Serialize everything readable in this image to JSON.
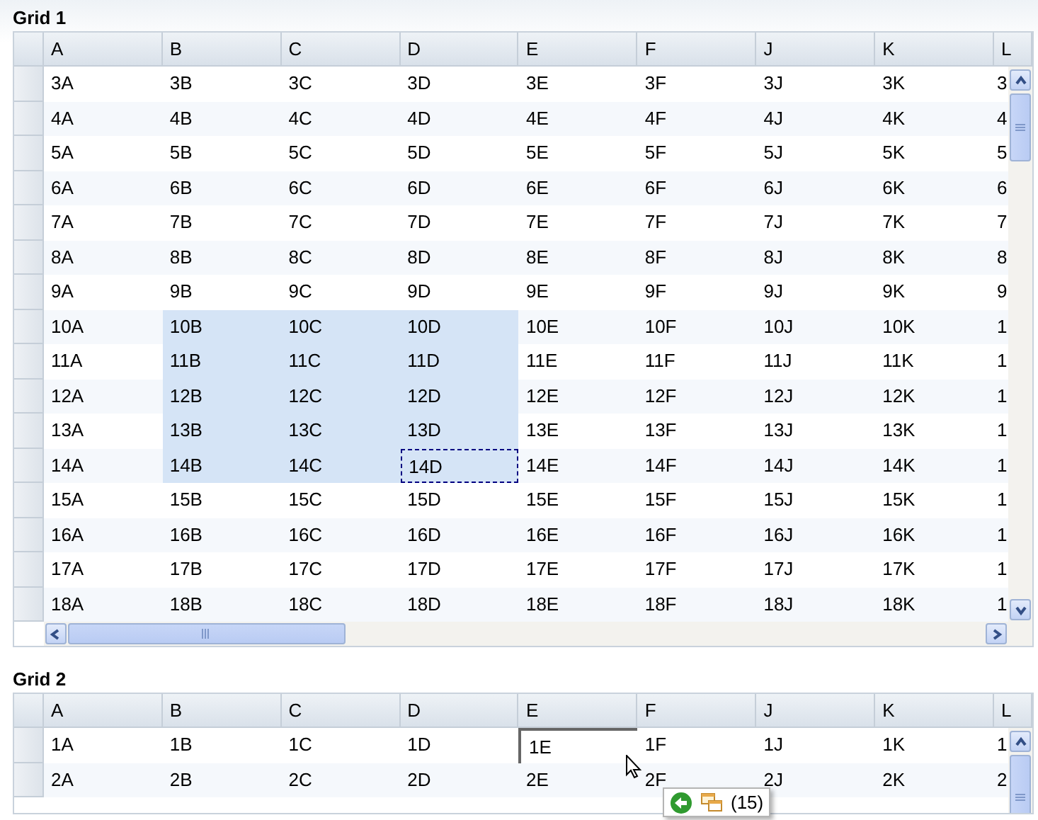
{
  "grids": [
    {
      "title": "Grid 1",
      "kind": "dashed",
      "columns": [
        "A",
        "B",
        "C",
        "D",
        "E",
        "F",
        "J",
        "K",
        "L"
      ],
      "rows": [
        {
          "cells": [
            {
              "text": "3A",
              "selected": false,
              "focused": false
            },
            {
              "text": "3B",
              "selected": false,
              "focused": false
            },
            {
              "text": "3C",
              "selected": false,
              "focused": false
            },
            {
              "text": "3D",
              "selected": false,
              "focused": false
            },
            {
              "text": "3E",
              "selected": false,
              "focused": false
            },
            {
              "text": "3F",
              "selected": false,
              "focused": false
            },
            {
              "text": "3J",
              "selected": false,
              "focused": false
            },
            {
              "text": "3K",
              "selected": false,
              "focused": false
            },
            {
              "text": "3",
              "selected": false,
              "focused": false
            }
          ]
        },
        {
          "cells": [
            {
              "text": "4A",
              "selected": false,
              "focused": false
            },
            {
              "text": "4B",
              "selected": false,
              "focused": false
            },
            {
              "text": "4C",
              "selected": false,
              "focused": false
            },
            {
              "text": "4D",
              "selected": false,
              "focused": false
            },
            {
              "text": "4E",
              "selected": false,
              "focused": false
            },
            {
              "text": "4F",
              "selected": false,
              "focused": false
            },
            {
              "text": "4J",
              "selected": false,
              "focused": false
            },
            {
              "text": "4K",
              "selected": false,
              "focused": false
            },
            {
              "text": "4",
              "selected": false,
              "focused": false
            }
          ]
        },
        {
          "cells": [
            {
              "text": "5A",
              "selected": false,
              "focused": false
            },
            {
              "text": "5B",
              "selected": false,
              "focused": false
            },
            {
              "text": "5C",
              "selected": false,
              "focused": false
            },
            {
              "text": "5D",
              "selected": false,
              "focused": false
            },
            {
              "text": "5E",
              "selected": false,
              "focused": false
            },
            {
              "text": "5F",
              "selected": false,
              "focused": false
            },
            {
              "text": "5J",
              "selected": false,
              "focused": false
            },
            {
              "text": "5K",
              "selected": false,
              "focused": false
            },
            {
              "text": "5",
              "selected": false,
              "focused": false
            }
          ]
        },
        {
          "cells": [
            {
              "text": "6A",
              "selected": false,
              "focused": false
            },
            {
              "text": "6B",
              "selected": false,
              "focused": false
            },
            {
              "text": "6C",
              "selected": false,
              "focused": false
            },
            {
              "text": "6D",
              "selected": false,
              "focused": false
            },
            {
              "text": "6E",
              "selected": false,
              "focused": false
            },
            {
              "text": "6F",
              "selected": false,
              "focused": false
            },
            {
              "text": "6J",
              "selected": false,
              "focused": false
            },
            {
              "text": "6K",
              "selected": false,
              "focused": false
            },
            {
              "text": "6",
              "selected": false,
              "focused": false
            }
          ]
        },
        {
          "cells": [
            {
              "text": "7A",
              "selected": false,
              "focused": false
            },
            {
              "text": "7B",
              "selected": false,
              "focused": false
            },
            {
              "text": "7C",
              "selected": false,
              "focused": false
            },
            {
              "text": "7D",
              "selected": false,
              "focused": false
            },
            {
              "text": "7E",
              "selected": false,
              "focused": false
            },
            {
              "text": "7F",
              "selected": false,
              "focused": false
            },
            {
              "text": "7J",
              "selected": false,
              "focused": false
            },
            {
              "text": "7K",
              "selected": false,
              "focused": false
            },
            {
              "text": "7",
              "selected": false,
              "focused": false
            }
          ]
        },
        {
          "cells": [
            {
              "text": "8A",
              "selected": false,
              "focused": false
            },
            {
              "text": "8B",
              "selected": false,
              "focused": false
            },
            {
              "text": "8C",
              "selected": false,
              "focused": false
            },
            {
              "text": "8D",
              "selected": false,
              "focused": false
            },
            {
              "text": "8E",
              "selected": false,
              "focused": false
            },
            {
              "text": "8F",
              "selected": false,
              "focused": false
            },
            {
              "text": "8J",
              "selected": false,
              "focused": false
            },
            {
              "text": "8K",
              "selected": false,
              "focused": false
            },
            {
              "text": "8",
              "selected": false,
              "focused": false
            }
          ]
        },
        {
          "cells": [
            {
              "text": "9A",
              "selected": false,
              "focused": false
            },
            {
              "text": "9B",
              "selected": false,
              "focused": false
            },
            {
              "text": "9C",
              "selected": false,
              "focused": false
            },
            {
              "text": "9D",
              "selected": false,
              "focused": false
            },
            {
              "text": "9E",
              "selected": false,
              "focused": false
            },
            {
              "text": "9F",
              "selected": false,
              "focused": false
            },
            {
              "text": "9J",
              "selected": false,
              "focused": false
            },
            {
              "text": "9K",
              "selected": false,
              "focused": false
            },
            {
              "text": "9",
              "selected": false,
              "focused": false
            }
          ]
        },
        {
          "cells": [
            {
              "text": "10A",
              "selected": false,
              "focused": false
            },
            {
              "text": "10B",
              "selected": true,
              "focused": false
            },
            {
              "text": "10C",
              "selected": true,
              "focused": false
            },
            {
              "text": "10D",
              "selected": true,
              "focused": false
            },
            {
              "text": "10E",
              "selected": false,
              "focused": false
            },
            {
              "text": "10F",
              "selected": false,
              "focused": false
            },
            {
              "text": "10J",
              "selected": false,
              "focused": false
            },
            {
              "text": "10K",
              "selected": false,
              "focused": false
            },
            {
              "text": "1",
              "selected": false,
              "focused": false
            }
          ]
        },
        {
          "cells": [
            {
              "text": "11A",
              "selected": false,
              "focused": false
            },
            {
              "text": "11B",
              "selected": true,
              "focused": false
            },
            {
              "text": "11C",
              "selected": true,
              "focused": false
            },
            {
              "text": "11D",
              "selected": true,
              "focused": false
            },
            {
              "text": "11E",
              "selected": false,
              "focused": false
            },
            {
              "text": "11F",
              "selected": false,
              "focused": false
            },
            {
              "text": "11J",
              "selected": false,
              "focused": false
            },
            {
              "text": "11K",
              "selected": false,
              "focused": false
            },
            {
              "text": "1",
              "selected": false,
              "focused": false
            }
          ]
        },
        {
          "cells": [
            {
              "text": "12A",
              "selected": false,
              "focused": false
            },
            {
              "text": "12B",
              "selected": true,
              "focused": false
            },
            {
              "text": "12C",
              "selected": true,
              "focused": false
            },
            {
              "text": "12D",
              "selected": true,
              "focused": false
            },
            {
              "text": "12E",
              "selected": false,
              "focused": false
            },
            {
              "text": "12F",
              "selected": false,
              "focused": false
            },
            {
              "text": "12J",
              "selected": false,
              "focused": false
            },
            {
              "text": "12K",
              "selected": false,
              "focused": false
            },
            {
              "text": "1",
              "selected": false,
              "focused": false
            }
          ]
        },
        {
          "cells": [
            {
              "text": "13A",
              "selected": false,
              "focused": false
            },
            {
              "text": "13B",
              "selected": true,
              "focused": false
            },
            {
              "text": "13C",
              "selected": true,
              "focused": false
            },
            {
              "text": "13D",
              "selected": true,
              "focused": false
            },
            {
              "text": "13E",
              "selected": false,
              "focused": false
            },
            {
              "text": "13F",
              "selected": false,
              "focused": false
            },
            {
              "text": "13J",
              "selected": false,
              "focused": false
            },
            {
              "text": "13K",
              "selected": false,
              "focused": false
            },
            {
              "text": "1",
              "selected": false,
              "focused": false
            }
          ]
        },
        {
          "cells": [
            {
              "text": "14A",
              "selected": false,
              "focused": false
            },
            {
              "text": "14B",
              "selected": true,
              "focused": false
            },
            {
              "text": "14C",
              "selected": true,
              "focused": false
            },
            {
              "text": "14D",
              "selected": true,
              "focused": true
            },
            {
              "text": "14E",
              "selected": false,
              "focused": false
            },
            {
              "text": "14F",
              "selected": false,
              "focused": false
            },
            {
              "text": "14J",
              "selected": false,
              "focused": false
            },
            {
              "text": "14K",
              "selected": false,
              "focused": false
            },
            {
              "text": "1",
              "selected": false,
              "focused": false
            }
          ]
        },
        {
          "cells": [
            {
              "text": "15A",
              "selected": false,
              "focused": false
            },
            {
              "text": "15B",
              "selected": false,
              "focused": false
            },
            {
              "text": "15C",
              "selected": false,
              "focused": false
            },
            {
              "text": "15D",
              "selected": false,
              "focused": false
            },
            {
              "text": "15E",
              "selected": false,
              "focused": false
            },
            {
              "text": "15F",
              "selected": false,
              "focused": false
            },
            {
              "text": "15J",
              "selected": false,
              "focused": false
            },
            {
              "text": "15K",
              "selected": false,
              "focused": false
            },
            {
              "text": "1",
              "selected": false,
              "focused": false
            }
          ]
        },
        {
          "cells": [
            {
              "text": "16A",
              "selected": false,
              "focused": false
            },
            {
              "text": "16B",
              "selected": false,
              "focused": false
            },
            {
              "text": "16C",
              "selected": false,
              "focused": false
            },
            {
              "text": "16D",
              "selected": false,
              "focused": false
            },
            {
              "text": "16E",
              "selected": false,
              "focused": false
            },
            {
              "text": "16F",
              "selected": false,
              "focused": false
            },
            {
              "text": "16J",
              "selected": false,
              "focused": false
            },
            {
              "text": "16K",
              "selected": false,
              "focused": false
            },
            {
              "text": "1",
              "selected": false,
              "focused": false
            }
          ]
        },
        {
          "cells": [
            {
              "text": "17A",
              "selected": false,
              "focused": false
            },
            {
              "text": "17B",
              "selected": false,
              "focused": false
            },
            {
              "text": "17C",
              "selected": false,
              "focused": false
            },
            {
              "text": "17D",
              "selected": false,
              "focused": false
            },
            {
              "text": "17E",
              "selected": false,
              "focused": false
            },
            {
              "text": "17F",
              "selected": false,
              "focused": false
            },
            {
              "text": "17J",
              "selected": false,
              "focused": false
            },
            {
              "text": "17K",
              "selected": false,
              "focused": false
            },
            {
              "text": "1",
              "selected": false,
              "focused": false
            }
          ]
        },
        {
          "cells": [
            {
              "text": "18A",
              "selected": false,
              "focused": false
            },
            {
              "text": "18B",
              "selected": false,
              "focused": false
            },
            {
              "text": "18C",
              "selected": false,
              "focused": false
            },
            {
              "text": "18D",
              "selected": false,
              "focused": false
            },
            {
              "text": "18E",
              "selected": false,
              "focused": false
            },
            {
              "text": "18F",
              "selected": false,
              "focused": false
            },
            {
              "text": "18J",
              "selected": false,
              "focused": false
            },
            {
              "text": "18K",
              "selected": false,
              "focused": false
            },
            {
              "text": "1",
              "selected": false,
              "focused": false
            }
          ]
        }
      ]
    },
    {
      "title": "Grid 2",
      "kind": "solid",
      "columns": [
        "A",
        "B",
        "C",
        "D",
        "E",
        "F",
        "J",
        "K",
        "L"
      ],
      "rows": [
        {
          "cells": [
            {
              "text": "1A",
              "selected": false,
              "focused": false
            },
            {
              "text": "1B",
              "selected": false,
              "focused": false
            },
            {
              "text": "1C",
              "selected": false,
              "focused": false
            },
            {
              "text": "1D",
              "selected": false,
              "focused": false
            },
            {
              "text": "1E",
              "selected": false,
              "focused": true
            },
            {
              "text": "1F",
              "selected": false,
              "focused": false
            },
            {
              "text": "1J",
              "selected": false,
              "focused": false
            },
            {
              "text": "1K",
              "selected": false,
              "focused": false
            },
            {
              "text": "1",
              "selected": false,
              "focused": false
            }
          ]
        },
        {
          "cells": [
            {
              "text": "2A",
              "selected": false,
              "focused": false
            },
            {
              "text": "2B",
              "selected": false,
              "focused": false
            },
            {
              "text": "2C",
              "selected": false,
              "focused": false
            },
            {
              "text": "2D",
              "selected": false,
              "focused": false
            },
            {
              "text": "2E",
              "selected": false,
              "focused": false
            },
            {
              "text": "2F",
              "selected": false,
              "focused": false
            },
            {
              "text": "2J",
              "selected": false,
              "focused": false
            },
            {
              "text": "2K",
              "selected": false,
              "focused": false
            },
            {
              "text": "2",
              "selected": false,
              "focused": false
            }
          ]
        }
      ]
    }
  ],
  "drag_tooltip": {
    "count": "(15)"
  }
}
